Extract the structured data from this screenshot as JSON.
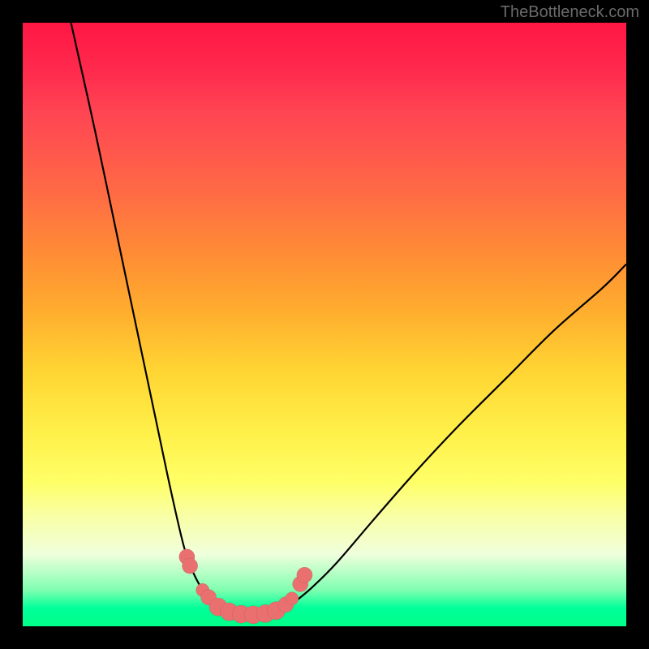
{
  "watermark": "TheBottleneck.com",
  "chart_data": {
    "type": "line",
    "title": "",
    "xlabel": "",
    "ylabel": "",
    "xlim": [
      0,
      100
    ],
    "ylim": [
      0,
      100
    ],
    "series": [
      {
        "name": "left-branch",
        "x": [
          8,
          12,
          16,
          20,
          24,
          26.5,
          28,
          29.5,
          31,
          32,
          33,
          34
        ],
        "y": [
          100,
          82,
          63,
          44,
          25,
          14,
          9.5,
          6.5,
          4.5,
          3.3,
          2.5,
          2.1
        ]
      },
      {
        "name": "floor",
        "x": [
          34,
          36,
          38,
          40,
          42,
          43
        ],
        "y": [
          2.1,
          1.9,
          1.85,
          1.9,
          2.2,
          2.6
        ]
      },
      {
        "name": "right-branch",
        "x": [
          43,
          45,
          48,
          52,
          58,
          65,
          72,
          80,
          88,
          96,
          100
        ],
        "y": [
          2.6,
          4.0,
          6.5,
          10.5,
          17.5,
          25.5,
          33,
          41,
          49,
          56,
          60
        ]
      }
    ],
    "markers": {
      "name": "highlight-points",
      "style": "pink-bead",
      "points": [
        {
          "x": 27.2,
          "y": 11.5,
          "r": 1.3
        },
        {
          "x": 27.7,
          "y": 10.0,
          "r": 1.3
        },
        {
          "x": 29.8,
          "y": 6.0,
          "r": 1.1
        },
        {
          "x": 30.8,
          "y": 4.8,
          "r": 1.3
        },
        {
          "x": 32.4,
          "y": 3.2,
          "r": 1.5
        },
        {
          "x": 34.2,
          "y": 2.4,
          "r": 1.5
        },
        {
          "x": 36.2,
          "y": 2.0,
          "r": 1.5
        },
        {
          "x": 38.2,
          "y": 1.9,
          "r": 1.5
        },
        {
          "x": 40.2,
          "y": 2.1,
          "r": 1.5
        },
        {
          "x": 42.0,
          "y": 2.6,
          "r": 1.5
        },
        {
          "x": 43.6,
          "y": 3.6,
          "r": 1.3
        },
        {
          "x": 44.6,
          "y": 4.6,
          "r": 1.1
        },
        {
          "x": 46.0,
          "y": 7.0,
          "r": 1.3
        },
        {
          "x": 46.7,
          "y": 8.5,
          "r": 1.3
        }
      ]
    }
  }
}
